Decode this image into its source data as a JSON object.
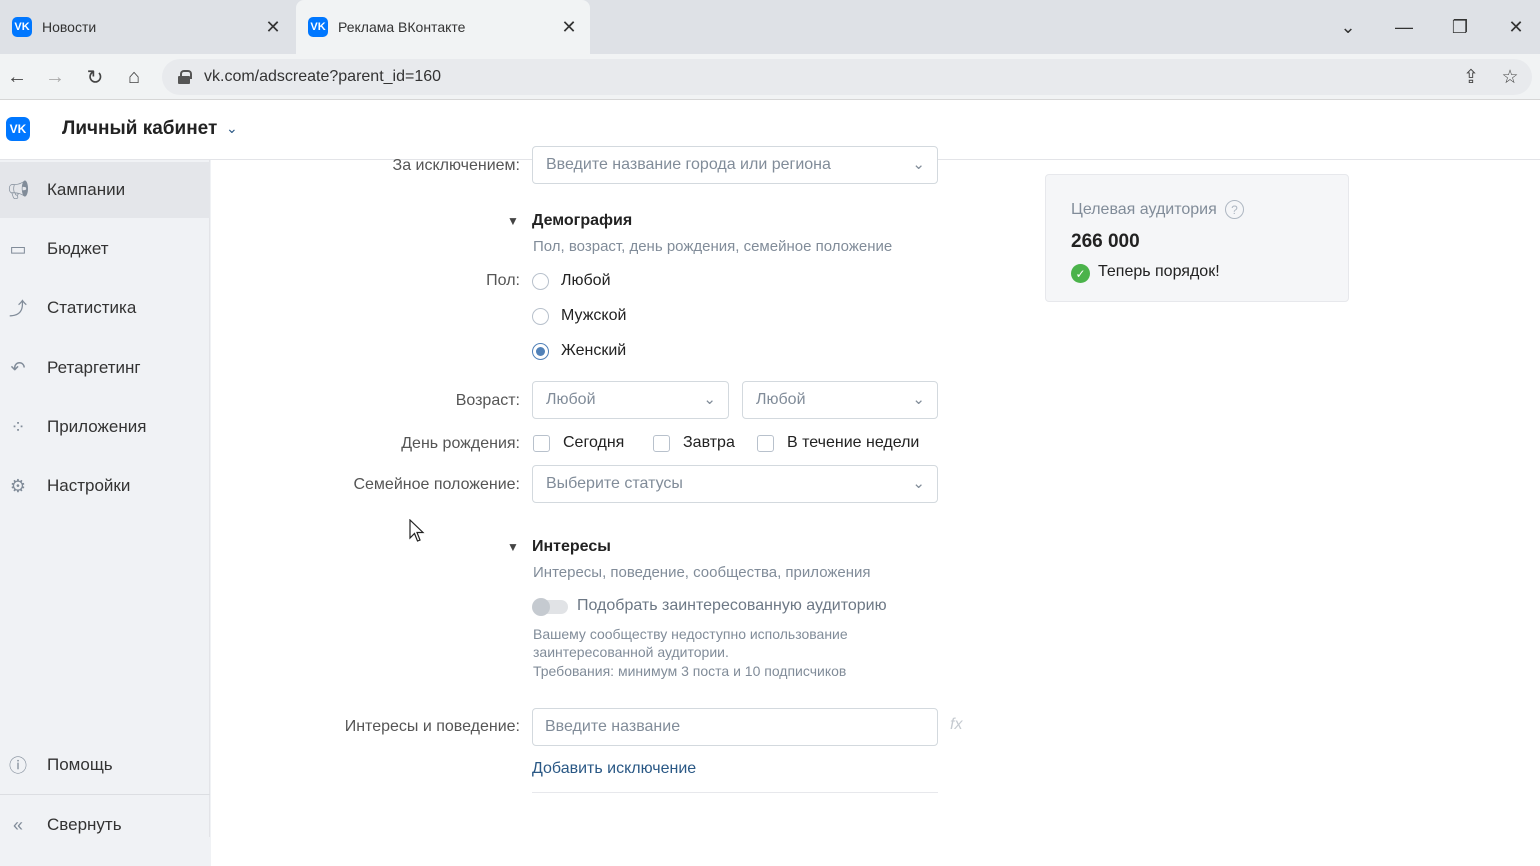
{
  "browser": {
    "tabs": [
      {
        "title": "Новости",
        "favicon": "vk-logo-icon"
      },
      {
        "title": "Реклама ВКонтакте",
        "favicon": "vk-logo-icon"
      }
    ],
    "url": "vk.com/adscreate?parent_id=160"
  },
  "header": {
    "title": "Личный кабинет"
  },
  "sidebar": {
    "items": [
      {
        "label": "Кампании",
        "icon": "megaphone-icon"
      },
      {
        "label": "Бюджет",
        "icon": "wallet-icon"
      },
      {
        "label": "Статистика",
        "icon": "chart-icon"
      },
      {
        "label": "Ретаргетинг",
        "icon": "retarget-icon"
      },
      {
        "label": "Приложения",
        "icon": "apps-icon"
      },
      {
        "label": "Настройки",
        "icon": "gear-icon"
      }
    ],
    "help": "Помощь",
    "collapse": "Свернуть"
  },
  "form": {
    "except": {
      "label": "За исключением:",
      "placeholder": "Введите название города или региона"
    },
    "demography": {
      "title": "Демография",
      "subtitle": "Пол, возраст, день рождения, семейное положение",
      "sex_label": "Пол:",
      "sex_options": [
        "Любой",
        "Мужской",
        "Женский"
      ],
      "sex_selected": "Женский",
      "age_label": "Возраст:",
      "age_from": "Любой",
      "age_to": "Любой",
      "birthday_label": "День рождения:",
      "birthday_options": [
        "Сегодня",
        "Завтра",
        "В течение недели"
      ],
      "family_label": "Семейное положение:",
      "family_placeholder": "Выберите статусы"
    },
    "interests": {
      "title": "Интересы",
      "subtitle": "Интересы, поведение, сообщества, приложения",
      "toggle_label": "Подобрать заинтересованную аудиторию",
      "note_line1": "Вашему сообществу недоступно использование",
      "note_line2": "заинтересованной аудитории.",
      "note_line3": "Требования: минимум 3 поста и 10 подписчиков",
      "behavior_label": "Интересы и поведение:",
      "behavior_placeholder": "Введите название",
      "fx": "fx",
      "add_exclusion": "Добавить исключение"
    }
  },
  "audience": {
    "title": "Целевая аудитория",
    "count": "266 000",
    "status": "Теперь порядок!"
  },
  "colors": {
    "accent": "#0077ff",
    "link": "#2a5885",
    "success": "#4bb34b"
  }
}
